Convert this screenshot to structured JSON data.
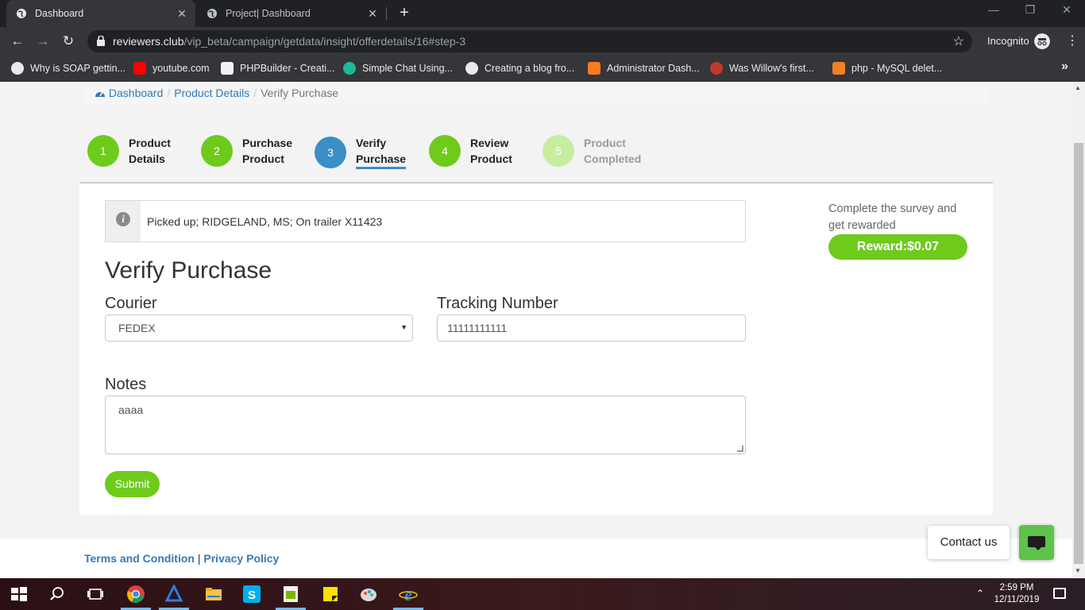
{
  "browser": {
    "tabs": [
      {
        "label": "Dashboard",
        "close": "✕"
      },
      {
        "label": "Project| Dashboard",
        "close": "✕"
      }
    ],
    "new_tab": "+",
    "url_host": "reviewers.club",
    "url_path": "/vip_beta/campaign/getdata/insight/offerdetails/16#step-3",
    "incognito_label": "Incognito",
    "bookmarks": [
      {
        "label": "Why is SOAP gettin...",
        "icon": "globe-icon",
        "color": "#e8eaed"
      },
      {
        "label": "youtube.com",
        "icon": "youtube-icon",
        "color": "#ff0000"
      },
      {
        "label": "PHPBuilder - Creati...",
        "icon": "php-icon",
        "color": "#f2f2f2"
      },
      {
        "label": "Simple Chat Using...",
        "icon": "chat-logo-icon",
        "color": "#1abc9c"
      },
      {
        "label": "Creating a blog fro...",
        "icon": "globe-icon",
        "color": "#e8eaed"
      },
      {
        "label": "Administrator Dash...",
        "icon": "xampp-icon",
        "color": "#fb7a24"
      },
      {
        "label": "Was Willow's first...",
        "icon": "scifi-icon",
        "color": "#c0392b"
      },
      {
        "label": "php - MySQL delet...",
        "icon": "stackoverflow-icon",
        "color": "#f48024"
      }
    ],
    "bookmarks_more": "»"
  },
  "breadcrumb": {
    "items": [
      "Dashboard",
      "Product Details"
    ],
    "current": "Verify Purchase",
    "separator": "/"
  },
  "steps": [
    {
      "num": "1",
      "line1": "Product",
      "line2": "Details",
      "state": "done"
    },
    {
      "num": "2",
      "line1": "Purchase",
      "line2": "Product",
      "state": "done"
    },
    {
      "num": "3",
      "line1": "Verify",
      "line2": "Purchase",
      "state": "active"
    },
    {
      "num": "4",
      "line1": "Review",
      "line2": "Product",
      "state": "done"
    },
    {
      "num": "5",
      "line1": "Product",
      "line2": "Completed",
      "state": "future"
    }
  ],
  "alert": {
    "text": "Picked up; RIDGELAND, MS; On trailer X11423",
    "icon": "info-icon"
  },
  "form": {
    "title": "Verify Purchase",
    "courier_label": "Courier",
    "courier_value": "FEDEX",
    "tracking_label": "Tracking Number",
    "tracking_value": "11111111111",
    "notes_label": "Notes",
    "notes_value": "aaaa",
    "submit_label": "Submit"
  },
  "reward": {
    "text": "Complete the survey and get rewarded",
    "button": "Reward:$0.07"
  },
  "footer": {
    "terms": "Terms and Condition",
    "pipe": "|",
    "privacy": "Privacy Policy"
  },
  "chat": {
    "contact_label": "Contact us"
  },
  "taskbar": {
    "time": "2:59 PM",
    "date": "12/11/2019"
  },
  "colors": {
    "accent_green": "#6ecb1b",
    "active_step_blue": "#3a8fc6",
    "link_blue": "#337ab7"
  }
}
